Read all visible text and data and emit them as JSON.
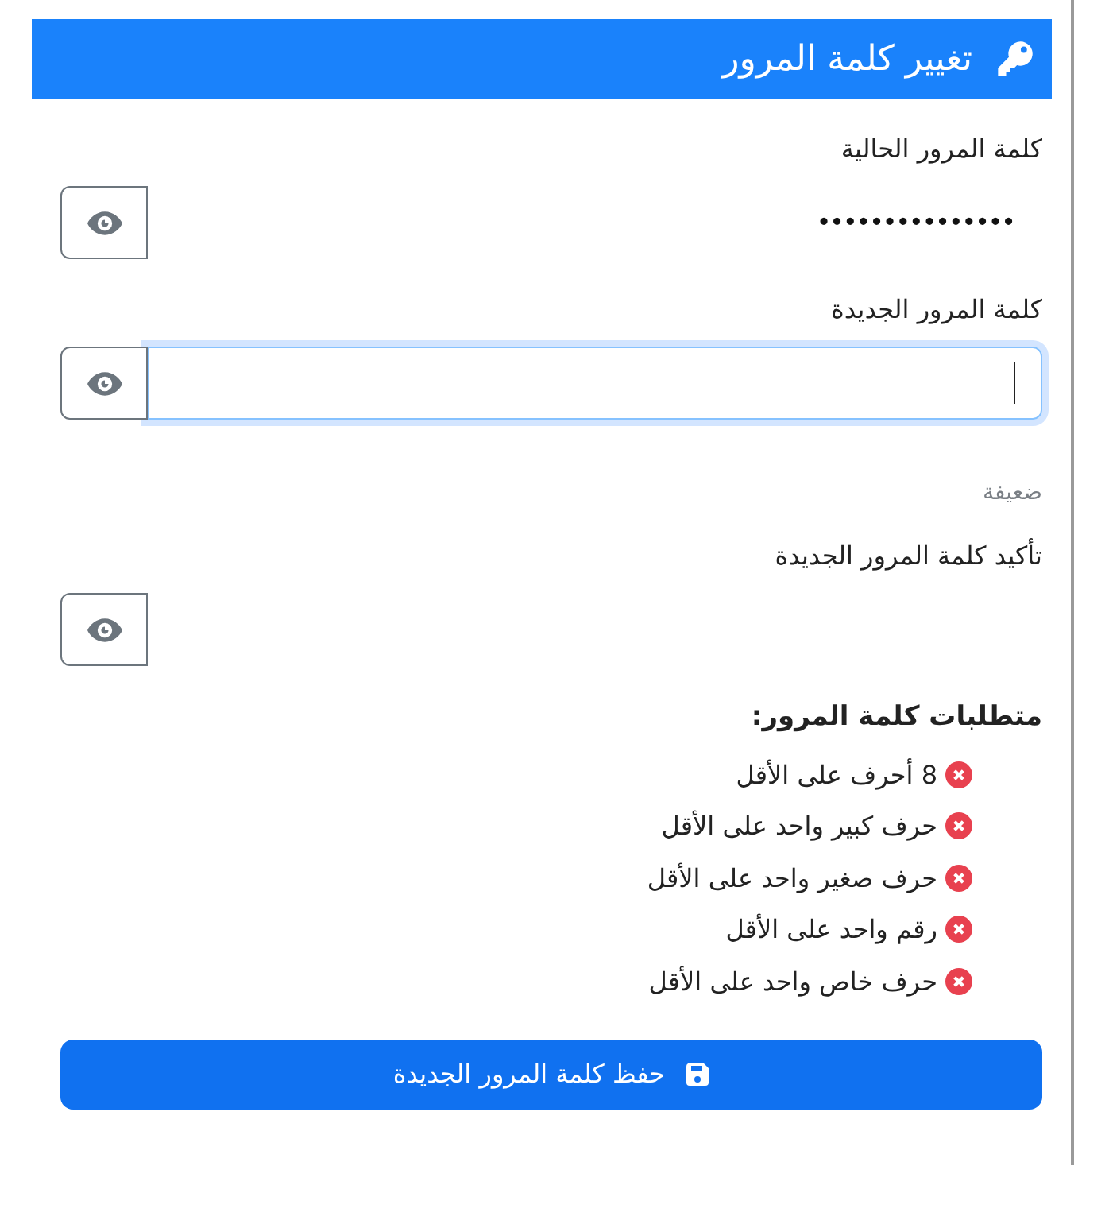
{
  "header": {
    "title": "تغيير كلمة المرور"
  },
  "fields": [
    {
      "label": "كلمة المرور الحالية",
      "value": "•••••••••••••••",
      "focused": false
    },
    {
      "label": "كلمة المرور الجديدة",
      "focused": true,
      "strength": "ضعيفة"
    },
    {
      "label": "تأكيد كلمة المرور الجديدة",
      "focused": false
    }
  ],
  "requirements": {
    "title": "متطلبات كلمة المرور:",
    "items": [
      {
        "text": "8 أحرف على الأقل",
        "met": false
      },
      {
        "text": "حرف كبير واحد على الأقل",
        "met": false
      },
      {
        "text": "حرف صغير واحد على الأقل",
        "met": false
      },
      {
        "text": "رقم واحد على الأقل",
        "met": false
      },
      {
        "text": "حرف خاص واحد على الأقل",
        "met": false
      }
    ]
  },
  "save_button": {
    "label": "حفظ كلمة المرور الجديدة"
  }
}
